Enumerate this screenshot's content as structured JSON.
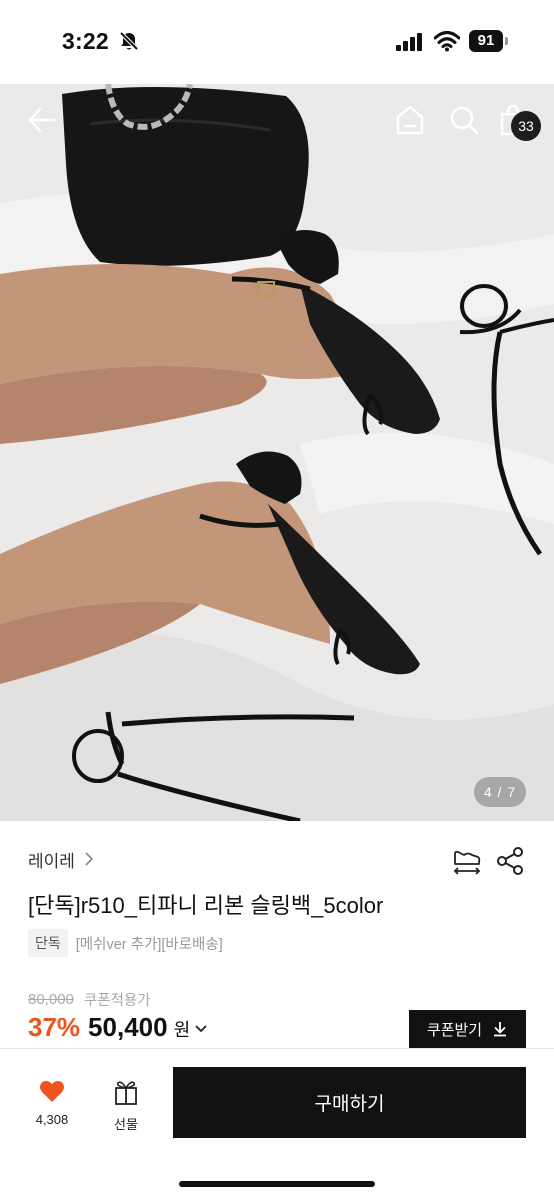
{
  "status_bar": {
    "time": "3:22",
    "battery": "91"
  },
  "header": {
    "icons": [
      "back-arrow-icon",
      "home-icon",
      "search-icon",
      "shopping-bag-icon"
    ],
    "cart_count": "33"
  },
  "gallery": {
    "counter": "4 / 7"
  },
  "product": {
    "brand": "레이레",
    "title": "[단독]r510_티파니 리본 슬링백_5color",
    "tag": "단독",
    "tag_note": "[메쉬ver 추가][바로배송]",
    "original_price": "80,000",
    "coupon_applied_label": "쿠폰적용가",
    "discount": "37%",
    "price": "50,400",
    "currency": "원",
    "coupon_button_label": "쿠폰받기"
  },
  "bottom_bar": {
    "like_count": "4,308",
    "gift_label": "선물",
    "buy_label": "구매하기"
  },
  "colors": {
    "accent_discount": "#f0541e",
    "like_heart": "#f0541e",
    "button_dark": "#111111"
  }
}
